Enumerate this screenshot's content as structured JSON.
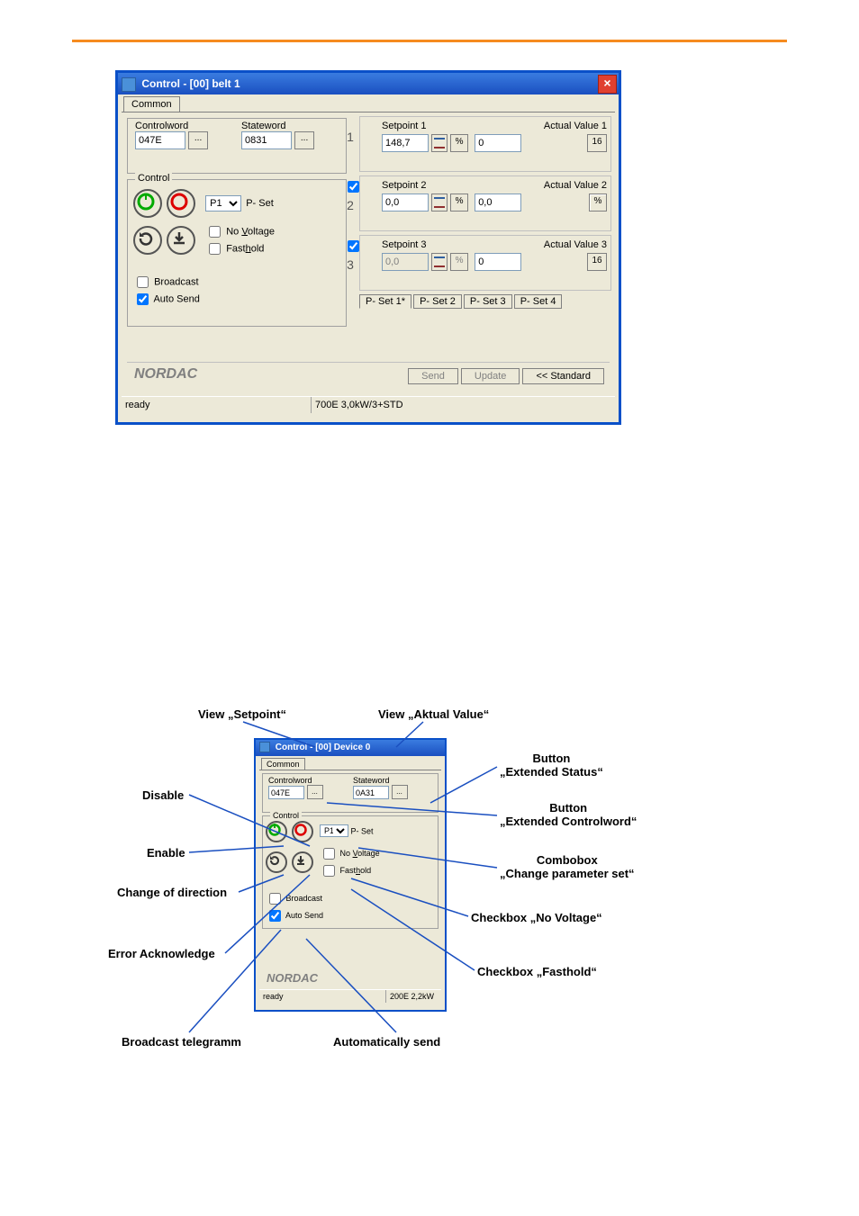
{
  "win1": {
    "title": "Control - [00] belt 1",
    "tab_common": "Common",
    "controlword_lbl": "Controlword",
    "controlword_val": "047E",
    "stateword_lbl": "Stateword",
    "stateword_val": "0831",
    "ext_btn": "...",
    "control_legend": "Control",
    "pset_combo": "P1",
    "pset_lbl": "P- Set",
    "no_voltage": "No Voltage",
    "fasthold": "Fasthold",
    "broadcast": "Broadcast",
    "autosend": "Auto Send",
    "sp": [
      {
        "n": "1",
        "sp_lbl": "Setpoint 1",
        "av_lbl": "Actual Value 1",
        "sp_val": "148,7",
        "av_val": "0",
        "u1": "%",
        "u2": "16",
        "enabled": true,
        "check": null
      },
      {
        "n": "2",
        "sp_lbl": "Setpoint 2",
        "av_lbl": "Actual Value 2",
        "sp_val": "0,0",
        "av_val": "0,0",
        "u1": "%",
        "u2": "%",
        "enabled": true,
        "check": true
      },
      {
        "n": "3",
        "sp_lbl": "Setpoint 3",
        "av_lbl": "Actual Value 3",
        "sp_val": "0,0",
        "av_val": "0",
        "u1": "%",
        "u2": "16",
        "enabled": false,
        "check": true
      }
    ],
    "psettabs": [
      "P- Set 1*",
      "P- Set 2",
      "P- Set 3",
      "P- Set 4"
    ],
    "brand": "NORDAC",
    "send": "Send",
    "update": "Update",
    "standard": "<< Standard",
    "status_left": "ready",
    "status_right": "700E 3,0kW/3+STD"
  },
  "fig2": {
    "cap_setpoint": "View „Setpoint“",
    "cap_actual": "View „Aktual Value“",
    "title": "Control - [00] Device 0",
    "tab_common": "Common",
    "controlword_lbl": "Controlword",
    "controlword_val": "047E",
    "stateword_lbl": "Stateword",
    "stateword_val": "0A31",
    "ext_btn": "...",
    "control_legend": "Control",
    "pset_combo": "P1",
    "pset_lbl": "P- Set",
    "no_voltage": "No Voltage",
    "fasthold": "Fasthold",
    "broadcast": "Broadcast",
    "autosend": "Auto Send",
    "brand": "NORDAC",
    "status_left": "ready",
    "status_right": "200E 2,2kW",
    "ann_disable": "Disable",
    "ann_enable": "Enable",
    "ann_chdir": "Change of direction",
    "ann_errack": "Error Acknowledge",
    "ann_broadcast": "Broadcast telegramm",
    "ann_autosend": "Automatically send",
    "ann_extstatus_l1": "Button",
    "ann_extstatus_l2": "„Extended Status“",
    "ann_extctrl_l1": "Button",
    "ann_extctrl_l2": "„Extended Controlword“",
    "ann_combo_l1": "Combobox",
    "ann_combo_l2": "„Change parameter set“",
    "ann_chk_nv": "Checkbox „No Voltage“",
    "ann_chk_fh": "Checkbox „Fasthold“"
  }
}
